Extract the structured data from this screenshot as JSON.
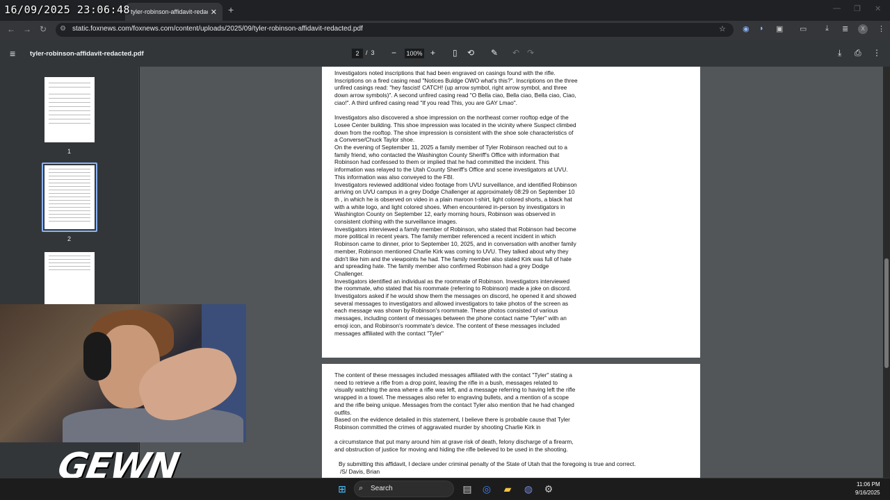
{
  "overlay": {
    "timestamp": "16/09/2025 23:06:48",
    "brand": "GEWN"
  },
  "browser": {
    "tabs": [
      {
        "label": "...",
        "close": ""
      },
      {
        "label": "tyler-robinson-affidavit-redacte",
        "close": "✕"
      }
    ],
    "new_tab": "+",
    "url": "static.foxnews.com/foxnews.com/content/uploads/2025/09/tyler-robinson-affidavit-redacted.pdf",
    "window_controls": [
      "—",
      "❐",
      "✕"
    ],
    "profile_initial": "X"
  },
  "pdf": {
    "title": "tyler-robinson-affidavit-redacted.pdf",
    "page_current": "2",
    "page_total": "3",
    "page_sep": "/",
    "zoom": "100%",
    "thumbnails": [
      {
        "label": "1"
      },
      {
        "label": "2"
      }
    ],
    "page2_paragraphs": [
      "Investigators noted inscriptions that had been engraved on casings found with the rifle. Inscriptions on a fired casing read \"Notices Buldge OWO what's this?\". Inscriptions on the three unfired casings read: \"hey fascist! CATCH! (up arrow symbol, right arrow symbol, and three down arrow symbols)\". A second unfired casing read \"O Bella ciao, Bella ciao, Bella ciao, Ciao, ciao!\". A third unfired casing read \"If you read This, you are GAY Lmao\".",
      "",
      "Investigators also discovered a shoe impression on the northeast corner rooftop edge of the Losee Center building. This shoe impression was located in the vicinity where Suspect climbed down from the rooftop. The shoe impression is consistent with the shoe sole characteristics of a Converse/Chuck Taylor shoe.",
      "On the evening of September 11, 2025 a family member of Tyler Robinson reached out to a family friend, who contacted the Washington County Sheriff's Office with information that Robinson had confessed to them or implied that he had committed the incident. This information was relayed to the Utah County Sheriff's Office and scene investigators at UVU. This information was also conveyed to the FBI.",
      "Investigators reviewed additional video footage from UVU surveillance, and identified Robinson arriving on UVU campus in a grey Dodge Challenger at approximately 08:29 on September 10 th , in which he is observed on video in a plain maroon t-shirt, light colored shorts, a black hat with a white logo, and light colored shoes. When encountered in-person by investigators in Washington County on September 12, early morning hours, Robinson was observed in consistent clothing with the surveillance images.",
      "Investigators interviewed a family member of Robinson, who stated that Robinson had become more political in recent years. The family member referenced a recent incident in which Robinson came to dinner, prior to September 10, 2025, and in conversation with another family member, Robinson mentioned Charlie Kirk was coming to UVU. They talked about why they didn't like him and the viewpoints he had. The family member also stated Kirk was full of hate and spreading hate. The family member also confirmed Robinson had a grey Dodge Challenger.",
      "Investigators identified an individual as the roommate of Robinson. Investigators interviewed the roommate, who stated that his roommate (referring to Robinson) made a joke on discord. Investigators asked if he would show them the messages on discord, he opened it and showed several messages to investigators and allowed investigators to take photos of the screen as each message was shown by Robinson's roommate. These photos consisted of various messages, including content of messages between the phone contact name \"Tyler\" with an emoji icon, and Robinson's roommate's device. The content of these messages included messages affiliated with the contact \"Tyler\""
    ],
    "page3_paragraphs": [
      "The content of these messages included messages affiliated with the contact \"Tyler\" stating a need to retrieve a rifle from a drop point, leaving the rifle in a bush, messages related to visually watching the area where a rifle was left, and a message referring to having left the rifle wrapped in a towel. The messages also refer to engraving bullets, and a mention of a scope and the rifle being unique. Messages from the contact Tyler also mention that he had changed outfits.",
      "Based on the evidence detailed in this statement, I believe there is probable cause that Tyler Robinson committed the crimes of aggravated murder by shooting Charlie Kirk in",
      "",
      "a circumstance that put many around him at grave risk of death, felony discharge of a firearm, and obstruction of justice for moving and hiding the rifle believed to be used in the shooting."
    ],
    "declaration": "By submitting this affidavit, I declare under criminal penalty of the State of Utah that the foregoing is true and correct.",
    "signature": "/S/ Davis, Brian"
  },
  "taskbar": {
    "search_label": "Search",
    "time": "11:06 PM",
    "date": "9/16/2025"
  }
}
